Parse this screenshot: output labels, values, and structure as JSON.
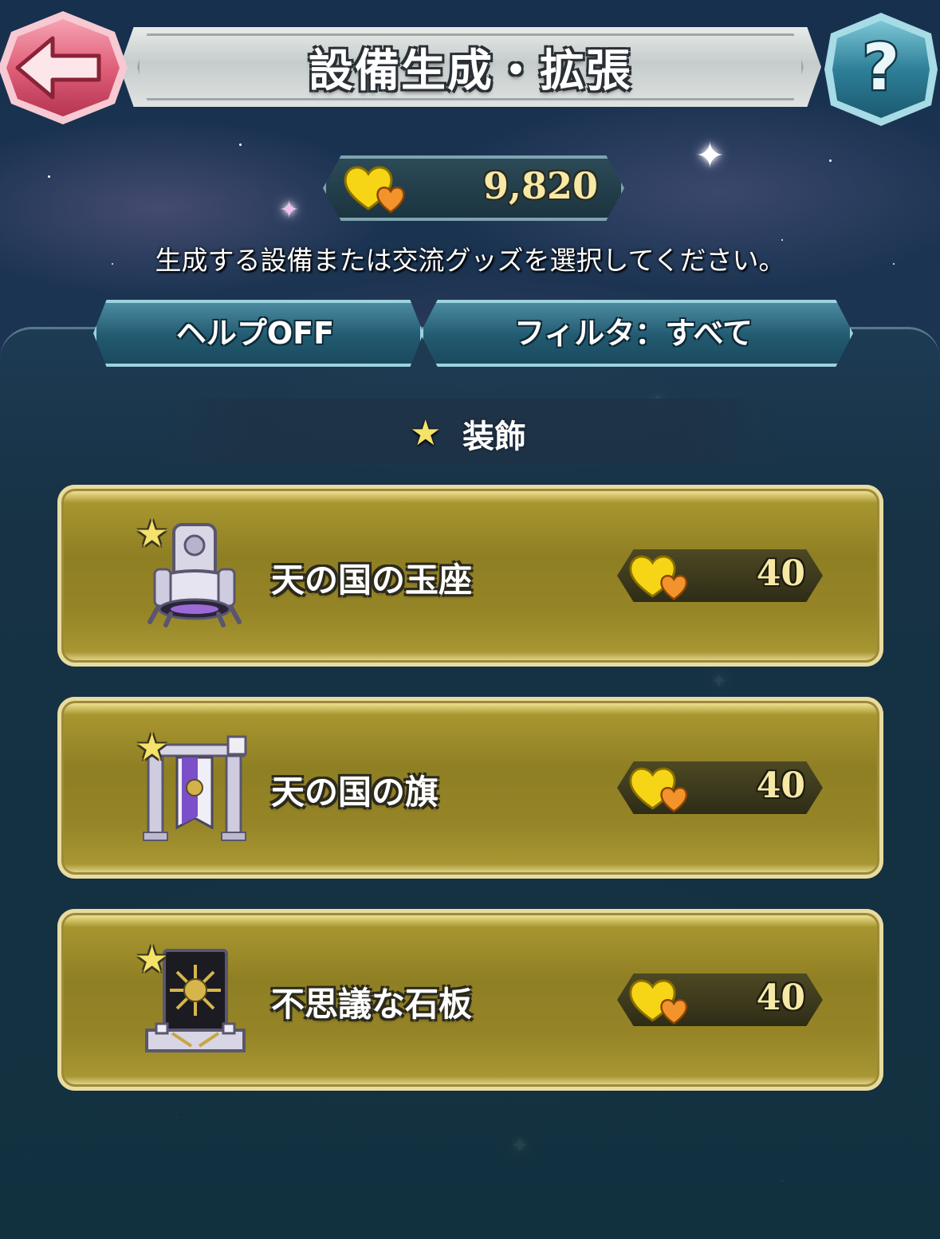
{
  "header": {
    "title": "設備生成・拡張",
    "back_icon": "back-arrow-icon",
    "help_icon": "question-mark-icon"
  },
  "currency": {
    "icon": "hearts-icon",
    "amount": "9,820"
  },
  "instruction": "生成する設備または交流グッズを選択してください。",
  "toggles": {
    "help": "ヘルプOFF",
    "filter": "フィルタ：すべて"
  },
  "category": {
    "label": "装飾",
    "icon": "star-icon"
  },
  "items": [
    {
      "name": "天の国の玉座",
      "icon": "throne-icon",
      "price": "40"
    },
    {
      "name": "天の国の旗",
      "icon": "banner-icon",
      "price": "40"
    },
    {
      "name": "不思議な石板",
      "icon": "stone-tablet-icon",
      "price": "40"
    }
  ],
  "colors": {
    "accent_gold": "#f6e9a6",
    "button_teal": "#225a70",
    "item_olive": "#8f7f24",
    "back_pink": "#e0607a"
  }
}
